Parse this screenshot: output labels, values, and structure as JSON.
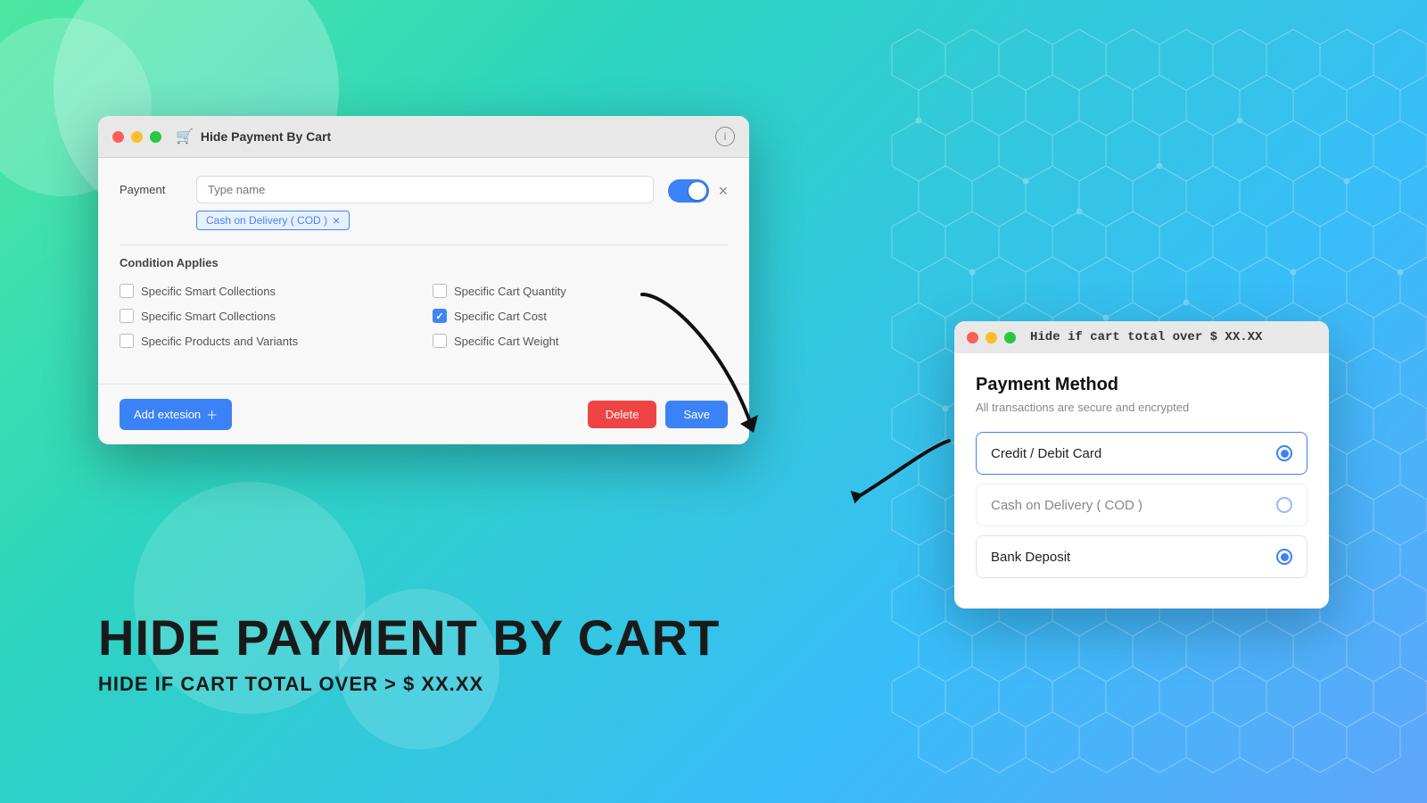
{
  "background": {
    "gradient_start": "#4de8a0",
    "gradient_end": "#60a5fa"
  },
  "main_window": {
    "title": "Hide Payment By Cart",
    "traffic_lights": {
      "red": "close",
      "yellow": "minimize",
      "green": "maximize"
    },
    "payment_label": "Payment",
    "payment_input_placeholder": "Type name",
    "tag_label": "Cash on Delivery ( COD )",
    "condition_title": "Condition Applies",
    "conditions": [
      {
        "id": "col1row1",
        "label": "Specific Smart Collections",
        "checked": false
      },
      {
        "id": "col2row1",
        "label": "Specific Cart Quantity",
        "checked": false
      },
      {
        "id": "col1row2",
        "label": "Specific Smart Collections",
        "checked": false
      },
      {
        "id": "col2row2",
        "label": "Specific Cart Cost",
        "checked": true
      },
      {
        "id": "col1row3",
        "label": "Specific Products and Variants",
        "checked": false
      },
      {
        "id": "col2row3",
        "label": "Specific Cart Weight",
        "checked": false
      }
    ],
    "add_extension_label": "Add extesion",
    "delete_label": "Delete",
    "save_label": "Save"
  },
  "hero_text": {
    "title": "HIDE PAYMENT BY CART",
    "subtitle": "HIDE IF CART TOTAL OVER > $ XX.XX"
  },
  "right_window": {
    "title": "Hide if cart total over $ XX.XX",
    "payment_method_title": "Payment Method",
    "secure_text": "All transactions are secure and encrypted",
    "payment_options": [
      {
        "label": "Credit / Debit Card",
        "selected": true,
        "dimmed": false
      },
      {
        "label": "Cash on Delivery ( COD )",
        "selected": false,
        "dimmed": true
      },
      {
        "label": "Bank Deposit",
        "selected": false,
        "dimmed": false
      }
    ]
  }
}
